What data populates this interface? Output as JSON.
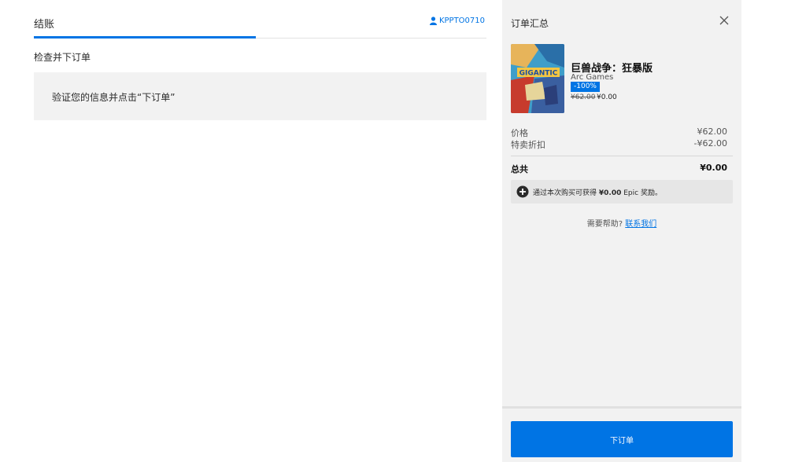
{
  "checkout": {
    "tab_title": "结账",
    "user_name": "KPPTO0710",
    "section_title": "检查并下订单",
    "notice_text": "验证您的信息并点击“下订单”"
  },
  "summary": {
    "title": "订单汇总",
    "product": {
      "name": "巨兽战争：狂暴版",
      "publisher": "Arc Games",
      "discount_badge": "-100%",
      "original_price": "¥62.00",
      "final_price": "¥0.00",
      "art_text": "GIGANTIC"
    },
    "price_label": "价格",
    "price_value": "¥62.00",
    "discount_label": "特卖折扣",
    "discount_value": "-¥62.00",
    "total_label": "总共",
    "total_value": "¥0.00",
    "reward": {
      "prefix": "通过本次购买可获得",
      "amount": "¥0.00",
      "suffix": "Epic 奖励。"
    },
    "help_prefix": "需要帮助?",
    "help_link": "联系我们",
    "place_order_label": "下订单"
  },
  "colors": {
    "accent": "#0074e4",
    "panel_bg": "#f2f2f2"
  }
}
